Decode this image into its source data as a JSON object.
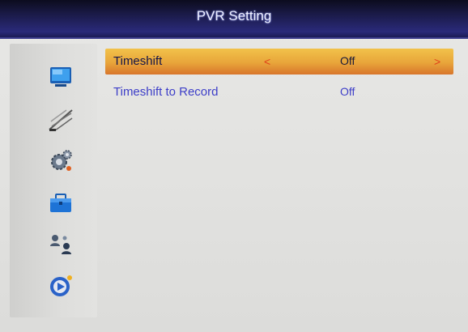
{
  "title": "PVR Setting",
  "menu_icons": [
    {
      "icon": "tv-screen-icon"
    },
    {
      "icon": "satellite-dish-icon"
    },
    {
      "icon": "settings-gear-icon"
    },
    {
      "icon": "toolbox-icon"
    },
    {
      "icon": "network-users-icon"
    },
    {
      "icon": "media-player-icon"
    }
  ],
  "settings": [
    {
      "label": "Timeshift",
      "value": "Off",
      "selected": true,
      "arrow_left": "<",
      "arrow_right": ">"
    },
    {
      "label": "Timeshift to Record",
      "value": "Off",
      "selected": false
    }
  ],
  "colors": {
    "title_bar": "#1b1b4a",
    "highlight": "#e8a53a",
    "text": "#3d3ec8",
    "arrow": "#e0401a",
    "background": "#e4e4e2"
  }
}
